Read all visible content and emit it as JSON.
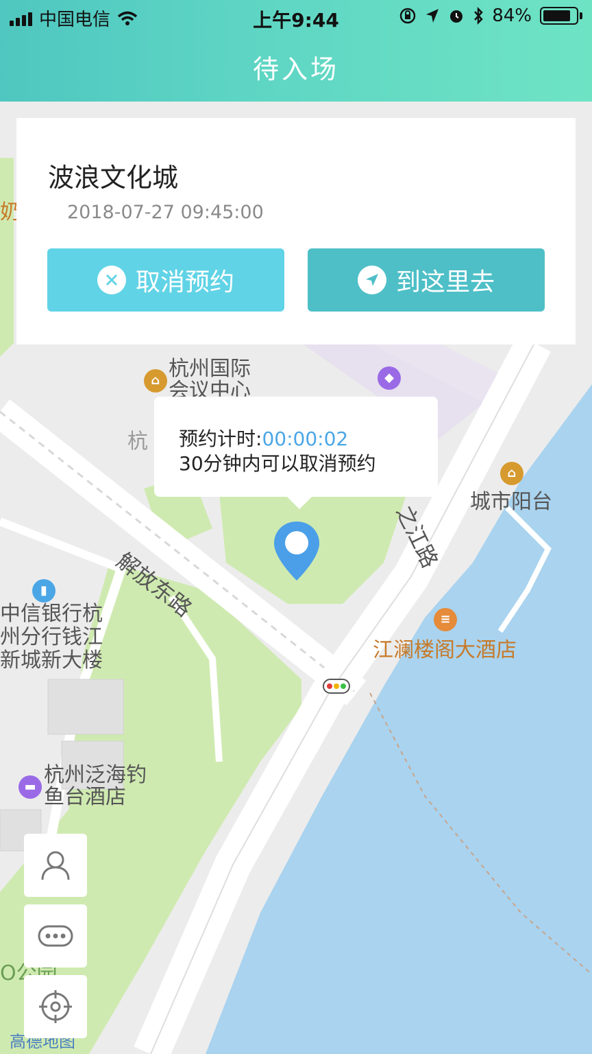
{
  "status_bar": {
    "carrier": "中国电信",
    "time": "上午9:44",
    "battery": "84%",
    "battery_level": 0.84
  },
  "nav": {
    "title": "待入场"
  },
  "card": {
    "place_name": "波浪文化城",
    "appointment_time": "2018-07-27 09:45:00",
    "cancel_label": "取消预约",
    "go_label": "到这里去"
  },
  "popup": {
    "timer_label": "预约计时:",
    "timer_value": "00:00:02",
    "cancel_note": "30分钟内可以取消预约"
  },
  "map": {
    "labels": {
      "convention_center": "杭州国际\n会议中心",
      "city_balcony": "城市阳台",
      "jiefang_road": "解放东路",
      "zhijiang_road": "之江路",
      "citic_bank": "中信银行杭\n州分行钱江\n新城新大楼",
      "jianglan_hotel": "江澜楼阁大酒店",
      "fanhai_hotel": "杭州泛海钓\n鱼台酒店",
      "partial_hang": "杭",
      "partial_park": "O公园",
      "partial_milk": "奶",
      "amap_logo": "高德地图"
    }
  },
  "controls": {
    "profile": "user-icon",
    "more": "more-icon",
    "locate": "locate-icon"
  },
  "colors": {
    "header_start": "#4fc7c0",
    "header_end": "#6ee3c4",
    "cancel_button": "#61d3e6",
    "go_button": "#4ebfc7",
    "timer": "#4ba6e6",
    "water": "#a9d3ef",
    "park": "#cfeab0",
    "pin": "#4a9fe8"
  }
}
